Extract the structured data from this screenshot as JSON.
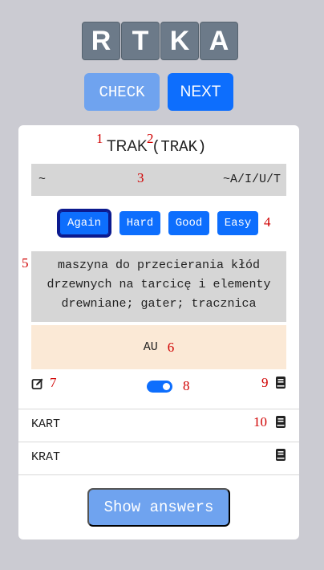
{
  "tiles": [
    "R",
    "T",
    "K",
    "A"
  ],
  "buttons": {
    "check": "CHECK",
    "next": "NEXT"
  },
  "card": {
    "word": "TRAK",
    "word_paren": "(TRAK)",
    "pattern_left": "~",
    "pattern_right": "~A/I/U/T",
    "ratings": [
      "Again",
      "Hard",
      "Good",
      "Easy"
    ],
    "active_rating": "Again",
    "definition": "maszyna do przecierania kłód drzewnych na tarcicę i elementy drewniane; gater; tracznica",
    "au_text": "AU",
    "toggle_on": true,
    "anagrams": [
      "KART",
      "KRAT"
    ],
    "show_answers": "Show answers"
  },
  "annotations": [
    "1",
    "2",
    "3",
    "4",
    "5",
    "6",
    "7",
    "8",
    "9",
    "10"
  ],
  "colors": {
    "primary": "#0d6efd",
    "primary_light": "#6fa3ef",
    "annotation": "#d00000"
  }
}
